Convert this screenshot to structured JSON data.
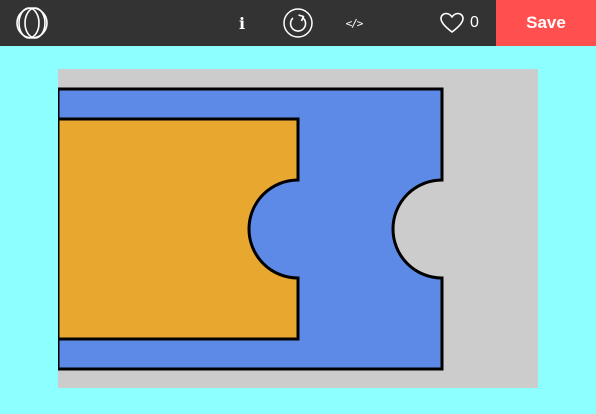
{
  "toolbar": {
    "logo_icon": "overlapping-circles-logo-icon",
    "info_label": "i",
    "refresh_icon": "refresh-icon",
    "code_label": "</>",
    "like_icon": "heart-icon",
    "like_count": "0",
    "save_label": "Save",
    "background_color": "#333333",
    "save_color": "#ff4f4f"
  },
  "canvas": {
    "page_background": "#8effff",
    "board_color": "#cccccc",
    "outer_piece_color": "#5c8ae6",
    "inner_piece_color": "#e8a830",
    "stroke_color": "#000000"
  }
}
